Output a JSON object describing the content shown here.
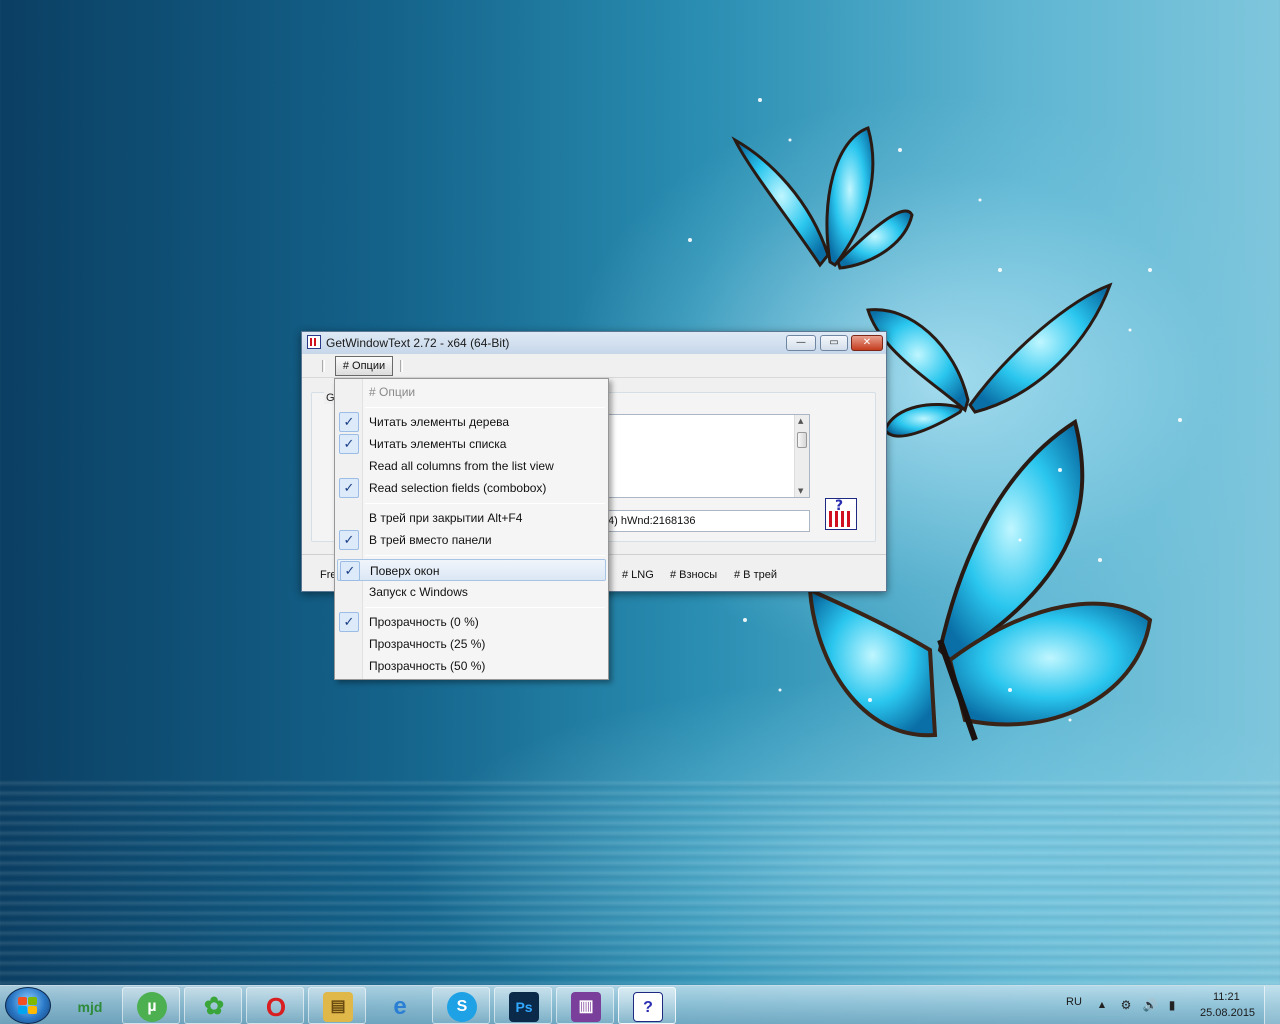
{
  "window": {
    "title": "GetWindowText 2.72 - x64 (64-Bit)",
    "min_glyph": "—",
    "max_glyph": "▭",
    "close_glyph": "✕",
    "menu_button": "# Опции",
    "group_label": "Ge",
    "hwnd_text": "4) hWnd:2168136",
    "status_items": [
      "Fre",
      "# LNG",
      "# Взносы",
      "# В трей"
    ]
  },
  "dropdown": {
    "items": [
      {
        "label": "# Опции",
        "checked": false,
        "header": true
      },
      {
        "label": "Читать элементы дерева",
        "checked": true
      },
      {
        "label": "Читать элементы списка",
        "checked": true
      },
      {
        "label": "Read all columns from the list view",
        "checked": false
      },
      {
        "label": "Read selection fields (combobox)",
        "checked": true
      },
      {
        "label": "В трей при закрытии Alt+F4",
        "checked": false
      },
      {
        "label": "В трей вместо панели",
        "checked": true
      },
      {
        "label": "Поверх окон",
        "checked": true,
        "hover": true
      },
      {
        "label": "Запуск с Windows",
        "checked": false
      },
      {
        "label": "Прозрачность (0 %)",
        "checked": true
      },
      {
        "label": "Прозрачность (25 %)",
        "checked": false
      },
      {
        "label": "Прозрачность (50 %)",
        "checked": false
      }
    ],
    "check_glyph": "✓"
  },
  "taskbar": {
    "apps": [
      {
        "name": "mjd",
        "text": "mjd",
        "color": "#2e8b3a"
      },
      {
        "name": "utorrent",
        "text": "µ",
        "color": "#4caf50"
      },
      {
        "name": "icq",
        "text": "✿",
        "color": "#3aa63a"
      },
      {
        "name": "opera",
        "text": "O",
        "color": "#d81e20"
      },
      {
        "name": "explorer",
        "text": "▤",
        "color": "#e0b84a"
      },
      {
        "name": "ie",
        "text": "e",
        "color": "#2a7fd4"
      },
      {
        "name": "skype",
        "text": "S",
        "color": "#1fa1e6"
      },
      {
        "name": "photoshop",
        "text": "Ps",
        "color": "#0b2a4a"
      },
      {
        "name": "winrar",
        "text": "▥",
        "color": "#7a3f9a"
      },
      {
        "name": "getwindowtext",
        "text": "?",
        "color": "#ffffff"
      }
    ],
    "lang": "RU",
    "time": "11:21",
    "date": "25.08.2015",
    "tray_up": "▲",
    "tray_icons": [
      "⚙",
      "🔊",
      "▮"
    ]
  },
  "colors": {
    "accent": "#2a78c6",
    "checked_bg": "#dceaf9",
    "close_red": "#c43c1e"
  }
}
